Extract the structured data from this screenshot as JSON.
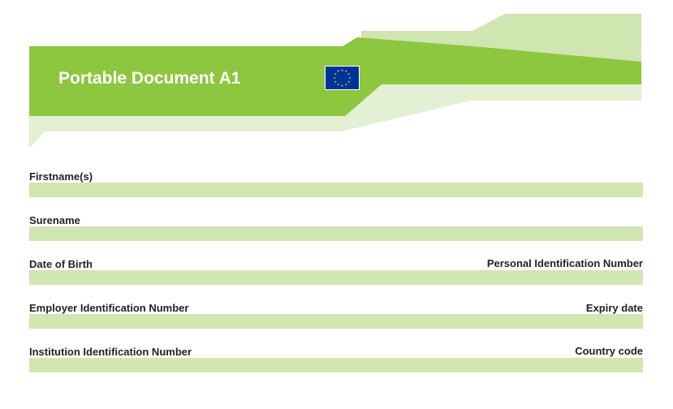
{
  "document": {
    "title": "Portable Document A1"
  },
  "colors": {
    "primary_green": "#8dc63f",
    "light_green": "#cfe6b0",
    "pale_green": "#e3f0d3",
    "field_fill": "#d1e7b1",
    "eu_blue": "#003399",
    "eu_star": "#ffcc00"
  },
  "icons": {
    "flag": "eu-flag-icon"
  },
  "fields": {
    "firstnames": {
      "label": "Firstname(s)",
      "value": ""
    },
    "surname": {
      "label": "Surename",
      "value": ""
    },
    "date_of_birth": {
      "label": "Date of Birth",
      "value": ""
    },
    "personal_id": {
      "label": "Personal Identification Number",
      "value": ""
    },
    "employer_id": {
      "label": "Employer Identification Number",
      "value": ""
    },
    "expiry_date": {
      "label": "Expiry date",
      "value": ""
    },
    "institution_id": {
      "label": "Institution Identification Number",
      "value": ""
    },
    "country_code": {
      "label": "Country code",
      "value": ""
    }
  }
}
